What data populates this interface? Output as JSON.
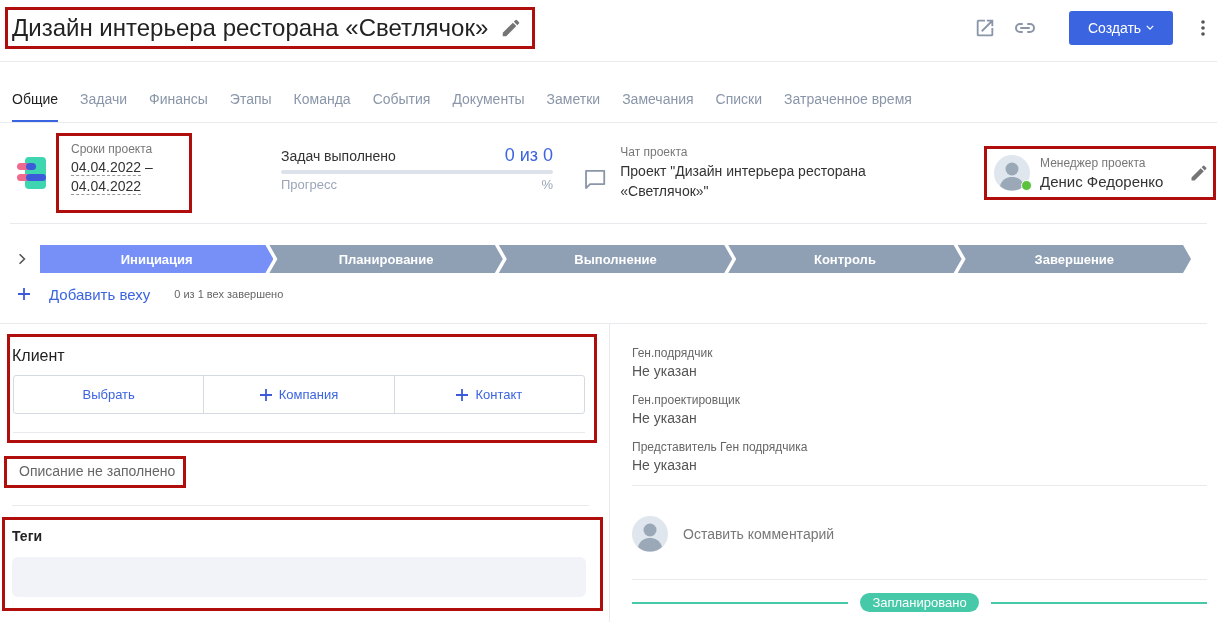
{
  "header": {
    "title": "Дизайн интерьера ресторана «Светлячок»",
    "highlighted": true,
    "create_button": "Создать"
  },
  "tabs": [
    {
      "label": "Общие",
      "selected": true
    },
    {
      "label": "Задачи",
      "selected": false
    },
    {
      "label": "Финансы",
      "selected": false
    },
    {
      "label": "Этапы",
      "selected": false
    },
    {
      "label": "Команда",
      "selected": false
    },
    {
      "label": "События",
      "selected": false
    },
    {
      "label": "Документы",
      "selected": false
    },
    {
      "label": "Заметки",
      "selected": false
    },
    {
      "label": "Замечания",
      "selected": false
    },
    {
      "label": "Списки",
      "selected": false
    },
    {
      "label": "Затраченное время",
      "selected": false
    }
  ],
  "dates": {
    "label": "Сроки проекта",
    "start": "04.04.2022",
    "separator": "–",
    "end": "04.04.2022",
    "highlighted": true
  },
  "tasks": {
    "label": "Задач выполнено",
    "count": "0 из 0",
    "progress_label": "Прогресс",
    "percent": "%",
    "level": 0
  },
  "chat": {
    "label": "Чат проекта",
    "name": "Проект \"Дизайн интерьера ресторана «Светлячок»\""
  },
  "manager": {
    "label": "Менеджер проекта",
    "name": "Денис Федоренко",
    "online": true,
    "highlighted": true
  },
  "stages": [
    {
      "label": "Инициация",
      "selected": true
    },
    {
      "label": "Планирование",
      "selected": false
    },
    {
      "label": "Выполнение",
      "selected": false
    },
    {
      "label": "Контроль",
      "selected": false
    },
    {
      "label": "Завершение",
      "selected": false
    }
  ],
  "milestones": {
    "add": "Добавить веху",
    "summary": "0 из 1 вех завершено"
  },
  "client": {
    "title": "Клиент",
    "highlighted": true,
    "buttons": [
      {
        "label": "Выбрать",
        "kind": "plain"
      },
      {
        "label": "Компания",
        "kind": "add"
      },
      {
        "label": "Контакт",
        "kind": "add"
      }
    ]
  },
  "description": {
    "text": "Описание не заполнено",
    "highlighted": true
  },
  "tags": {
    "title": "Теги",
    "highlighted": true
  },
  "contractors": [
    {
      "label": "Ген.подрядчик",
      "value": "Не указан"
    },
    {
      "label": "Ген.проектировщик",
      "value": "Не указан"
    },
    {
      "label": "Представитель Ген подрядчика",
      "value": "Не указан"
    }
  ],
  "comment": {
    "placeholder": "Оставить комментарий"
  },
  "status": {
    "label": "Запланировано"
  }
}
